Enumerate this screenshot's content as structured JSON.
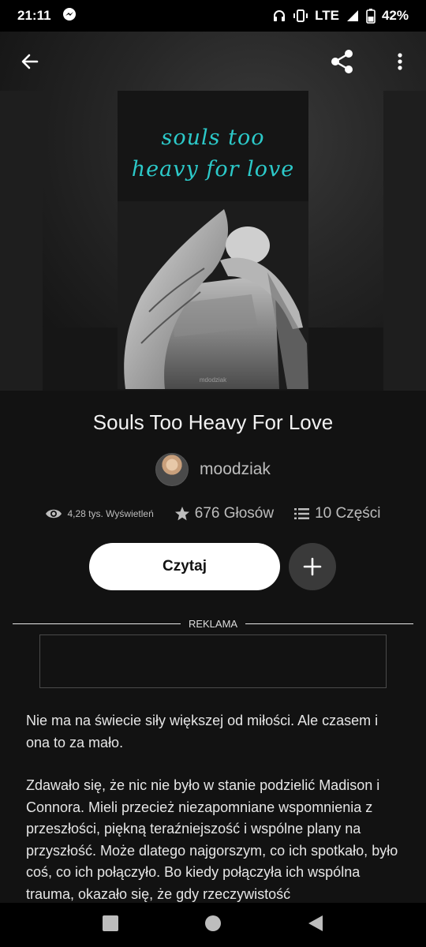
{
  "status_bar": {
    "time": "21:11",
    "network": "LTE",
    "battery": "42%",
    "icons": [
      "messenger-icon",
      "headphones-icon",
      "vibrate-icon",
      "signal-icon",
      "battery-icon"
    ]
  },
  "header": {
    "back_icon": "arrow-left-icon",
    "share_icon": "share-icon",
    "more_icon": "more-vertical-icon"
  },
  "cover": {
    "title_line1": "souls too",
    "title_line2": "heavy for love",
    "watermark": "mdodziak",
    "title_color": "#2cc9c9"
  },
  "story": {
    "title": "Souls Too Heavy For Love",
    "author": "moodziak",
    "stats": {
      "reads": "4,28 tys. Wyświetleń",
      "votes": "676 Głosów",
      "parts": "10 Części"
    }
  },
  "actions": {
    "read_label": "Czytaj",
    "add_icon": "plus-icon"
  },
  "ad": {
    "label": "REKLAMA"
  },
  "description": {
    "paragraph1": "Nie ma na świecie siły większej od miłości. Ale czasem i ona to za mało.",
    "paragraph2": "Zdawało się, że nic nie było w stanie podzielić Madison i Connora. Mieli przecież niezapomniane wspomnienia z przeszłości, piękną teraźniejszość i wspólne plany na przyszłość. Może dlatego najgorszym, co ich spotkało, było coś, co ich połączyło. Bo kiedy połączyła ich wspólna trauma, okazało się, że gdy rzeczywistość"
  },
  "navigation": {
    "icons": [
      "recents-square-icon",
      "home-circle-icon",
      "back-triangle-icon"
    ]
  }
}
